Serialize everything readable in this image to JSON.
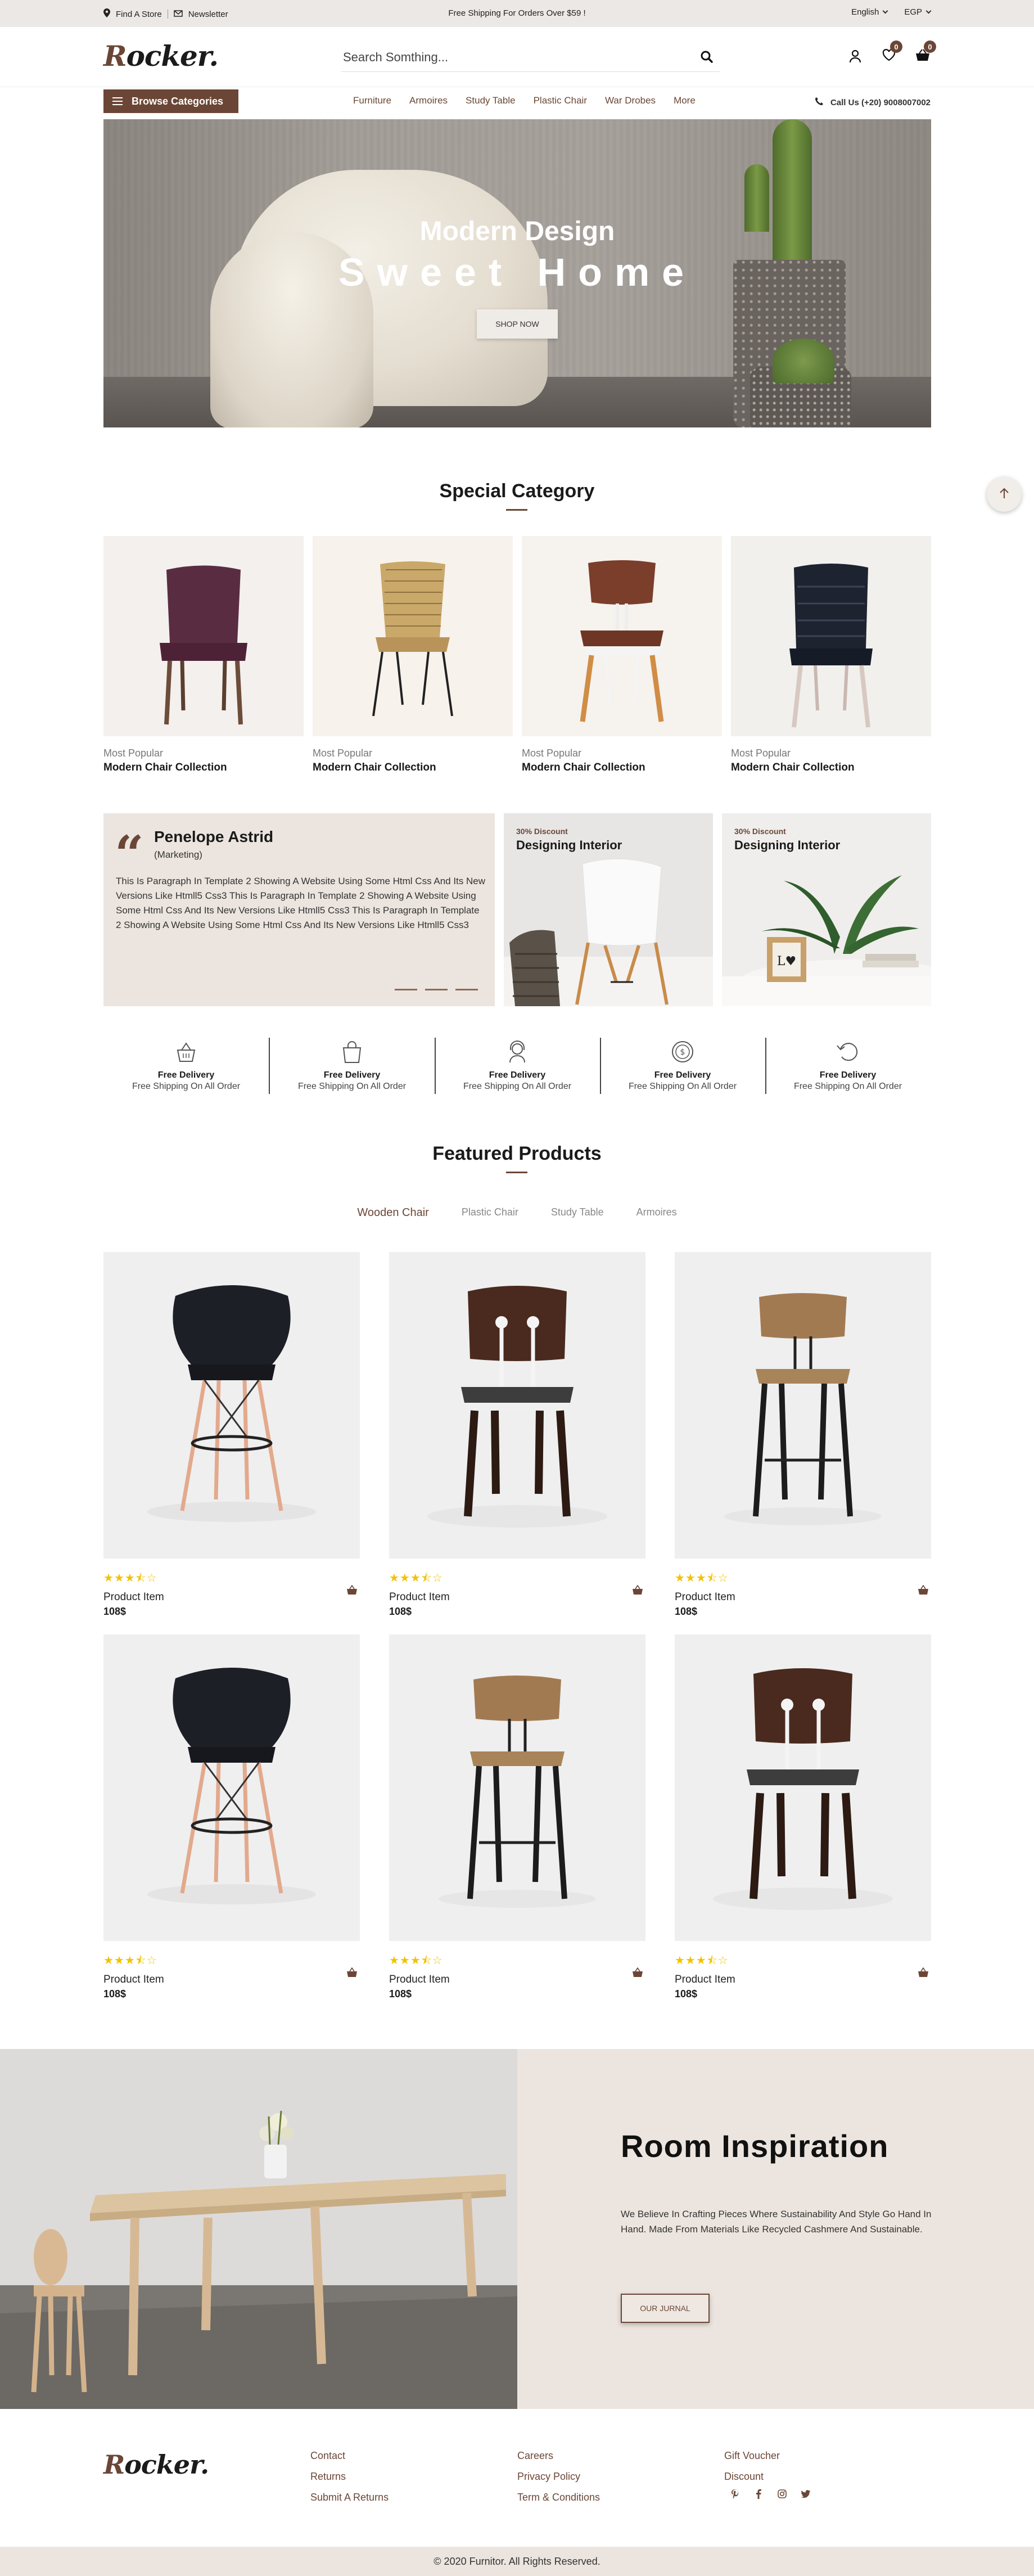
{
  "topbar": {
    "find_store": "Find A Store",
    "newsletter": "Newsletter",
    "promo": "Free Shipping For Orders Over $59 !",
    "language": "English",
    "currency": "EGP"
  },
  "header": {
    "logo_r": "R",
    "logo_rest": "ocker.",
    "search_placeholder": "Search Somthing...",
    "wishlist_count": "0",
    "cart_count": "0"
  },
  "nav": {
    "browse": "Browse Categories",
    "links": [
      "Furniture",
      "Armoires",
      "Study Table",
      "Plastic Chair",
      "War Drobes",
      "More"
    ],
    "call": "Call Us (+20) 9008007002"
  },
  "hero": {
    "subtitle": "Modern Design",
    "title": "Sweet Home",
    "button": "SHOP NOW"
  },
  "special": {
    "title": "Special Category",
    "items": [
      {
        "label": "Most Popular",
        "name": "Modern Chair Collection"
      },
      {
        "label": "Most Popular",
        "name": "Modern Chair Collection"
      },
      {
        "label": "Most Popular",
        "name": "Modern Chair Collection"
      },
      {
        "label": "Most Popular",
        "name": "Modern Chair Collection"
      }
    ]
  },
  "testimonial": {
    "name": "Penelope Astrid",
    "role": "(Marketing)",
    "text": "This Is Paragraph In Template 2 Showing A Website Using Some Html Css And Its New Versions Like Htmll5 Css3 This Is Paragraph In Template 2 Showing A Website Using Some Html Css And Its New Versions Like Htmll5 Css3 This Is Paragraph In Template 2 Showing A Website Using Some Html Css And Its New Versions Like Htmll5 Css3"
  },
  "discounts": [
    {
      "pct": "30% Discount",
      "title": "Designing Interior"
    },
    {
      "pct": "30% Discount",
      "title": "Designing Interior"
    }
  ],
  "features": [
    {
      "title": "Free Delivery",
      "sub": "Free Shipping On All Order",
      "icon": "basket-icon"
    },
    {
      "title": "Free Delivery",
      "sub": "Free Shipping On All Order",
      "icon": "bag-icon"
    },
    {
      "title": "Free Delivery",
      "sub": "Free Shipping On All Order",
      "icon": "support-icon"
    },
    {
      "title": "Free Delivery",
      "sub": "Free Shipping On All Order",
      "icon": "coin-icon"
    },
    {
      "title": "Free Delivery",
      "sub": "Free Shipping On All Order",
      "icon": "return-icon"
    }
  ],
  "featured": {
    "title": "Featured Products",
    "tabs": [
      "Wooden Chair",
      "Plastic Chair",
      "Study Table",
      "Armoires"
    ],
    "products": [
      {
        "name": "Product Item",
        "price": "108$",
        "rating": 3.5
      },
      {
        "name": "Product Item",
        "price": "108$",
        "rating": 3.5
      },
      {
        "name": "Product Item",
        "price": "108$",
        "rating": 3.5
      },
      {
        "name": "Product Item",
        "price": "108$",
        "rating": 3.5
      },
      {
        "name": "Product Item",
        "price": "108$",
        "rating": 3.5
      },
      {
        "name": "Product Item",
        "price": "108$",
        "rating": 3.5
      }
    ]
  },
  "room": {
    "title": "Room Inspiration",
    "text": "We Believe In Crafting Pieces Where Sustainability And Style Go Hand In Hand. Made From Materials Like Recycled Cashmere And Sustainable.",
    "button": "OUR JURNAL"
  },
  "footer": {
    "col1": [
      "Contact",
      "Returns",
      "Submit A Returns"
    ],
    "col2": [
      "Careers",
      "Privacy Policy",
      "Term & Conditions"
    ],
    "col3": [
      "Gift Voucher",
      "Discount"
    ],
    "social": [
      "pinterest-icon",
      "facebook-icon",
      "instagram-icon",
      "twitter-icon"
    ],
    "copyright": "© 2020 Furnitor. All Rights Reserved."
  },
  "colors": {
    "accent": "#6b4636",
    "star": "#f2c200",
    "panel": "#ece5df"
  }
}
